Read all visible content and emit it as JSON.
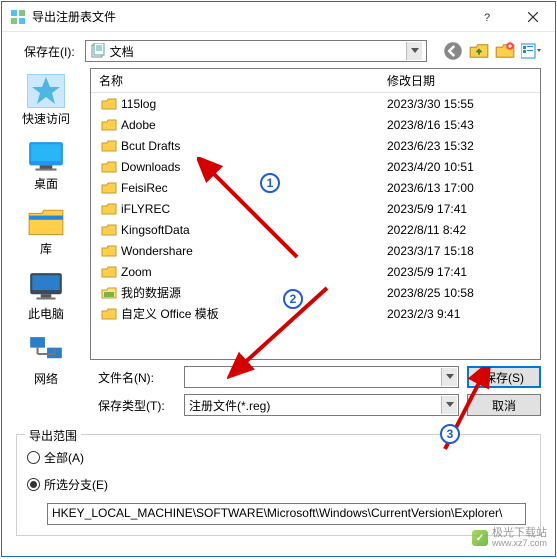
{
  "titlebar": {
    "title": "导出注册表文件"
  },
  "savein": {
    "label": "保存在(I):",
    "value": "文档"
  },
  "places": {
    "quick": "快速访问",
    "desktop": "桌面",
    "library": "库",
    "thispc": "此电脑",
    "network": "网络"
  },
  "filelist": {
    "header": {
      "name": "名称",
      "date": "修改日期"
    },
    "rows": [
      {
        "name": "115log",
        "date": "2023/3/30 15:55",
        "type": "folder"
      },
      {
        "name": "Adobe",
        "date": "2023/8/16 15:43",
        "type": "folder"
      },
      {
        "name": "Bcut Drafts",
        "date": "2023/6/23 15:32",
        "type": "folder"
      },
      {
        "name": "Downloads",
        "date": "2023/4/20 10:51",
        "type": "folder"
      },
      {
        "name": "FeisiRec",
        "date": "2023/6/13 17:00",
        "type": "folder"
      },
      {
        "name": "iFLYREC",
        "date": "2023/5/9 17:41",
        "type": "folder"
      },
      {
        "name": "KingsoftData",
        "date": "2022/8/11 8:42",
        "type": "folder"
      },
      {
        "name": "Wondershare",
        "date": "2023/3/17 15:18",
        "type": "folder"
      },
      {
        "name": "Zoom",
        "date": "2023/5/9 17:41",
        "type": "folder"
      },
      {
        "name": "我的数据源",
        "date": "2023/8/25 10:58",
        "type": "datasource"
      },
      {
        "name": "自定义 Office 模板",
        "date": "2023/2/3 9:41",
        "type": "folder"
      }
    ]
  },
  "form": {
    "filename_label": "文件名(N):",
    "filetype_label": "保存类型(T):",
    "filetype_value": "注册文件(*.reg)",
    "save_btn": "保存(S)",
    "cancel_btn": "取消"
  },
  "scope": {
    "title": "导出范围",
    "all": "全部(A)",
    "branch": "所选分支(E)",
    "branch_path": "HKEY_LOCAL_MACHINE\\SOFTWARE\\Microsoft\\Windows\\CurrentVersion\\Explorer\\"
  },
  "annotations": {
    "b1": "1",
    "b2": "2",
    "b3": "3"
  },
  "watermark": {
    "text": "极光下载站",
    "url": "www.xz7.com"
  }
}
